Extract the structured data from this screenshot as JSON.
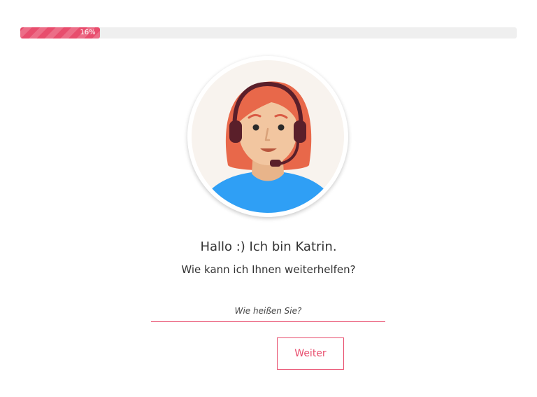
{
  "progress": {
    "percent": 16,
    "label": "16%"
  },
  "avatar": {
    "icon": "support-agent-avatar",
    "name": "Katrin"
  },
  "intro": {
    "greeting": "Hallo :) Ich bin Katrin.",
    "question": "Wie kann ich Ihnen weiterhelfen?"
  },
  "name_field": {
    "placeholder": "Wie heißen Sie?",
    "value": ""
  },
  "actions": {
    "continue_label": "Weiter"
  },
  "colors": {
    "accent": "#e84d6d",
    "hair": "#e8684a",
    "skin": "#f2c6a0",
    "shirt": "#2f9ff5",
    "headset": "#5a1f2a",
    "avatar_bg": "#f8f3ee",
    "track": "#efefef",
    "text": "#333333"
  }
}
